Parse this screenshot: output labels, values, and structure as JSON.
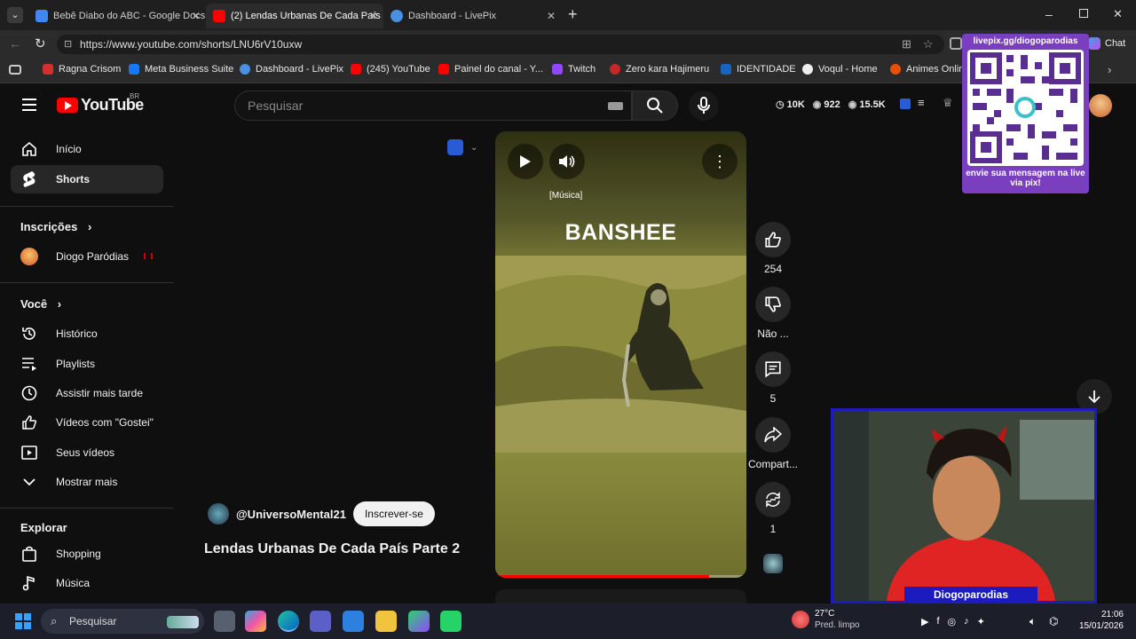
{
  "browser": {
    "tabs": [
      {
        "label": "Bebê Diabo do ABC - Google Docs",
        "color": "#4285f4"
      },
      {
        "label": "(2) Lendas Urbanas De Cada País P",
        "color": "#ff0000"
      },
      {
        "label": "Dashboard - LivePix",
        "color": "#4a90e2"
      }
    ],
    "url": "https://www.youtube.com/shorts/LNU6rV10uxw",
    "chat_label": "Chat",
    "bookmarks": [
      {
        "label": "Ragna Crisom",
        "color": "#d32f2f"
      },
      {
        "label": "Meta Business Suite",
        "color": "#1877f2"
      },
      {
        "label": "Dashboard - LivePix",
        "color": "#4a90e2"
      },
      {
        "label": "(245) YouTube",
        "color": "#ff0000"
      },
      {
        "label": "Painel do canal - Y...",
        "color": "#ff0000"
      },
      {
        "label": "Twitch",
        "color": "#9146ff"
      },
      {
        "label": "Zero kara Hajimeru",
        "color": "#c62828"
      },
      {
        "label": "IDENTIDADE",
        "color": "#1565c0"
      },
      {
        "label": "Voqul - Home",
        "color": "#eeeeee"
      },
      {
        "label": "Animes Online",
        "color": "#e65100"
      }
    ]
  },
  "youtube": {
    "logo_text": "YouTube",
    "logo_country": "BR",
    "search_placeholder": "Pesquisar",
    "stats": {
      "likes": "10K",
      "views": "922",
      "watch": "15.5K"
    },
    "sidebar": {
      "main": [
        {
          "label": "Início",
          "icon": "home-icon"
        },
        {
          "label": "Shorts",
          "icon": "shorts-icon"
        }
      ],
      "subs_heading": "Inscrições",
      "subs": [
        {
          "label": "Diogo Paródias"
        }
      ],
      "you_heading": "Você",
      "you": [
        {
          "label": "Histórico",
          "icon": "history-icon"
        },
        {
          "label": "Playlists",
          "icon": "playlist-icon"
        },
        {
          "label": "Assistir mais tarde",
          "icon": "clock-icon"
        },
        {
          "label": "Vídeos com \"Gostei\"",
          "icon": "thumbs-up-icon"
        },
        {
          "label": "Seus vídeos",
          "icon": "video-icon"
        },
        {
          "label": "Mostrar mais",
          "icon": "chevron-down-icon"
        }
      ],
      "explore_heading": "Explorar",
      "explore": [
        {
          "label": "Shopping",
          "icon": "bag-icon"
        },
        {
          "label": "Música",
          "icon": "music-icon"
        }
      ]
    },
    "short": {
      "title_overlay": "BANSHEE",
      "tag": "[Música]",
      "progress": 0.85,
      "channel": "@UniversoMental21",
      "subscribe": "Inscrever-se",
      "video_title": "Lendas Urbanas De Cada País Parte 2",
      "actions": {
        "likes": "254",
        "dislike": "Não ...",
        "comments": "5",
        "share": "Compart...",
        "remix": "1"
      }
    }
  },
  "overlay": {
    "qr_header": "livepix.gg/diogoparodias",
    "qr_footer": "envie sua mensagem na live via pix!",
    "streamer": "Diogoparodias"
  },
  "taskbar": {
    "search": "Pesquisar",
    "weather_temp": "27°C",
    "weather_desc": "Pred. limpo",
    "time": "21:06",
    "date": "15/01/2026"
  }
}
